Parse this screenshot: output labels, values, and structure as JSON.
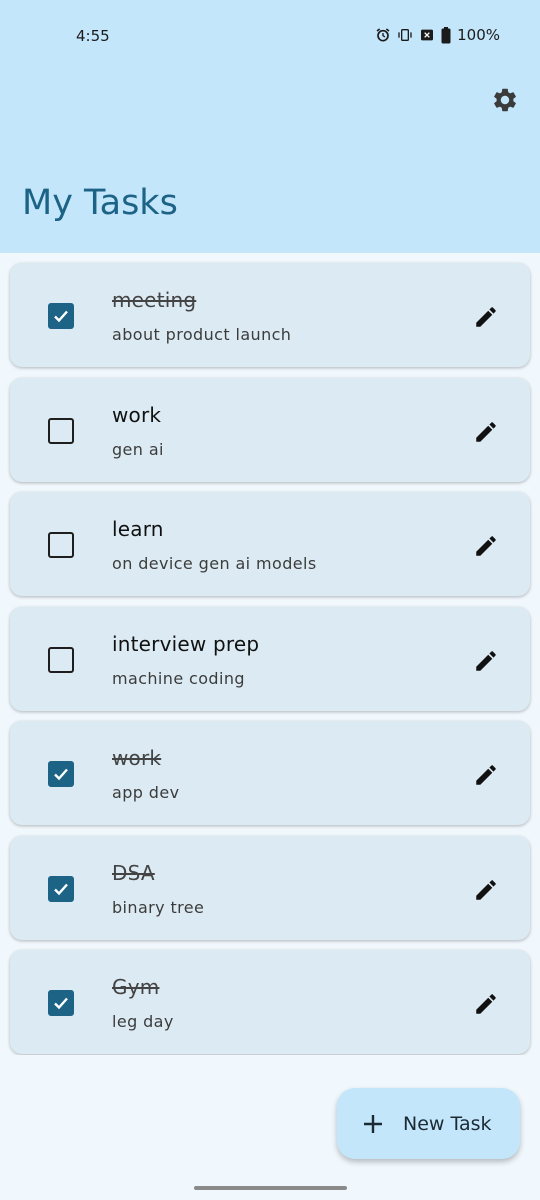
{
  "status_bar": {
    "time": "4:55",
    "battery": "100%",
    "icons": [
      "alarm-icon",
      "vibrate-icon",
      "no-sim-icon",
      "battery-icon"
    ]
  },
  "header": {
    "title": "My Tasks",
    "settings_icon": "gear-icon"
  },
  "tasks": [
    {
      "title": "meeting",
      "description": "about product launch",
      "done": true
    },
    {
      "title": "work",
      "description": "gen ai",
      "done": false
    },
    {
      "title": "learn",
      "description": "on device gen ai models",
      "done": false
    },
    {
      "title": "interview prep",
      "description": "machine coding",
      "done": false
    },
    {
      "title": "work",
      "description": "app dev",
      "done": true
    },
    {
      "title": "DSA",
      "description": "binary tree",
      "done": true
    },
    {
      "title": "Gym",
      "description": "leg day",
      "done": true
    }
  ],
  "fab": {
    "label": "New Task",
    "icon": "plus-icon"
  },
  "colors": {
    "header_bg": "#c3e6fb",
    "accent": "#1d6386",
    "card_bg": "#dcebf3",
    "page_bg": "#f1f8fd"
  }
}
